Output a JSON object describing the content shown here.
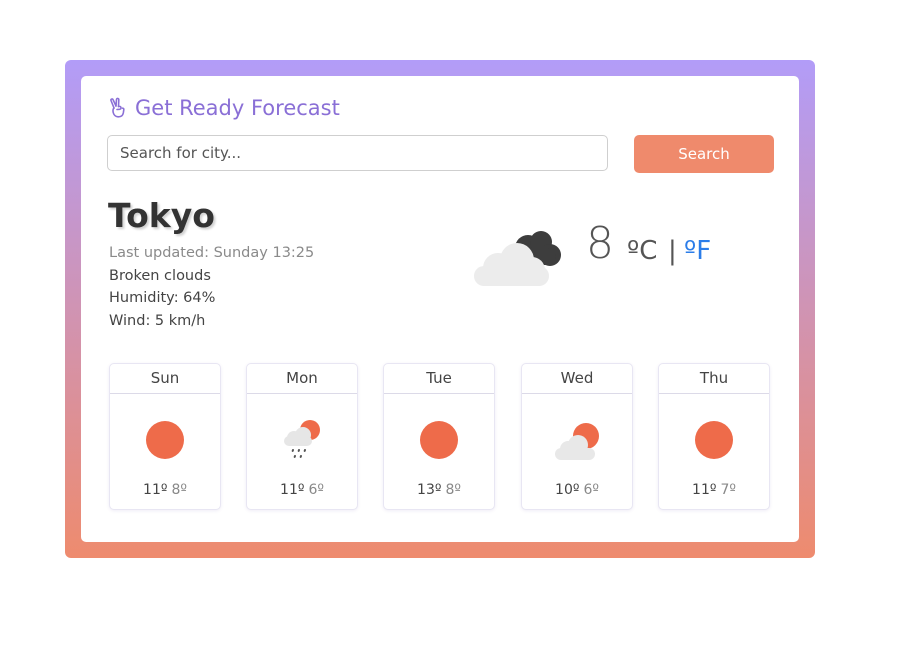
{
  "app": {
    "title": "Get Ready Forecast",
    "brand_icon": "victory-hand-icon",
    "accent_color": "#8a6fd6",
    "button_color": "#ef8a6c"
  },
  "search": {
    "placeholder": "Search for city...",
    "value": "",
    "button_label": "Search"
  },
  "current": {
    "city": "Tokyo",
    "updated": "Last updated: Sunday 13:25",
    "description": "Broken clouds",
    "humidity": "Humidity: 64%",
    "wind": "Wind: 5 km/h",
    "icon": "broken-clouds-icon",
    "temperature": "8",
    "unit_celsius": "ºC",
    "unit_separator": "|",
    "unit_fahrenheit": "ºF"
  },
  "forecast": [
    {
      "day": "Sun",
      "icon": "sun-icon",
      "max": "11º",
      "min": "8º"
    },
    {
      "day": "Mon",
      "icon": "rain-sun-icon",
      "max": "11º",
      "min": "6º"
    },
    {
      "day": "Tue",
      "icon": "sun-icon",
      "max": "13º",
      "min": "8º"
    },
    {
      "day": "Wed",
      "icon": "cloud-sun-icon",
      "max": "10º",
      "min": "6º"
    },
    {
      "day": "Thu",
      "icon": "sun-icon",
      "max": "11º",
      "min": "7º"
    }
  ]
}
